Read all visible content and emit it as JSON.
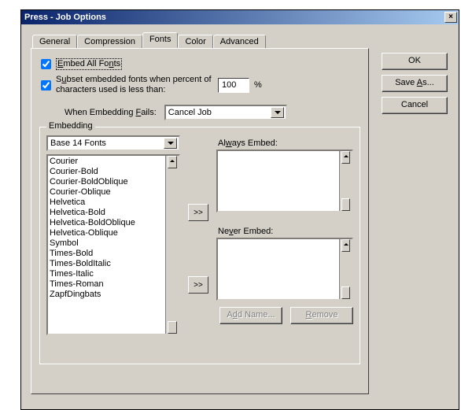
{
  "title": "Press - Job Options",
  "close_x": "×",
  "tabs": {
    "general": "General",
    "compression": "Compression",
    "fonts": "Fonts",
    "color": "Color",
    "advanced": "Advanced"
  },
  "embed_all": {
    "pre": "E",
    "mid": "mbed All Fo",
    "u2": "n",
    "post": "ts"
  },
  "subset": {
    "pre1": "S",
    "u1": "u",
    "rest": "bset embedded fonts when percent of characters used is less than:"
  },
  "subset_value": "100",
  "percent": "%",
  "fail_label": {
    "pre": "When Embedding ",
    "u": "F",
    "post": "ails:"
  },
  "fail_value": "Cancel Job",
  "fieldset": "Embedding",
  "font_source": "Base 14 Fonts",
  "font_list": [
    "Courier",
    "Courier-Bold",
    "Courier-BoldOblique",
    "Courier-Oblique",
    "Helvetica",
    "Helvetica-Bold",
    "Helvetica-BoldOblique",
    "Helvetica-Oblique",
    "Symbol",
    "Times-Bold",
    "Times-BoldItalic",
    "Times-Italic",
    "Times-Roman",
    "ZapfDingbats"
  ],
  "always_label": {
    "pre": "Al",
    "u": "w",
    "post": "ays Embed:"
  },
  "never_label": {
    "pre": "Ne",
    "u": "v",
    "post": "er Embed:"
  },
  "move_glyph": ">>",
  "add_name": {
    "pre": "A",
    "u": "d",
    "post": "d Name..."
  },
  "remove": {
    "u": "R",
    "post": "emove"
  },
  "ok": "OK",
  "save_as": {
    "pre": "Save ",
    "u": "A",
    "post": "s..."
  },
  "cancel": "Cancel"
}
